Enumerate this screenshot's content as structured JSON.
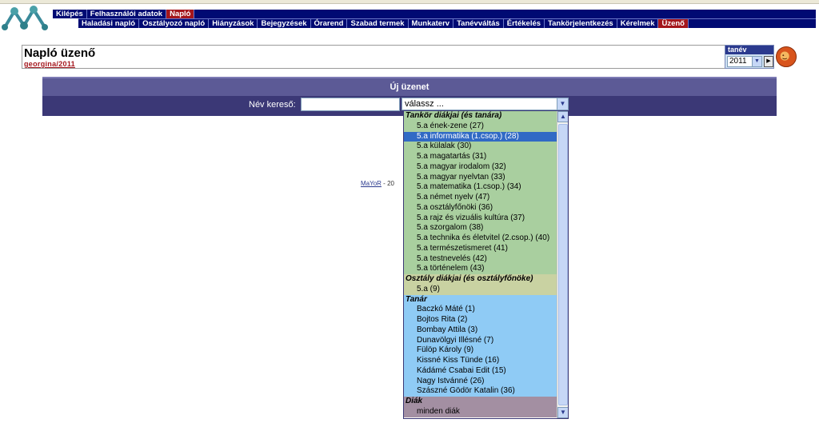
{
  "nav_top": [
    "Kilépés",
    "Felhasználói adatok",
    "Napló"
  ],
  "nav_sub": [
    "Haladási napló",
    "Osztályozó napló",
    "Hiányzások",
    "Bejegyzések",
    "Órarend",
    "Szabad termek",
    "Munkaterv",
    "Tanévváltás",
    "Értékelés",
    "Tankörjelentkezés",
    "Kérelmek",
    "Üzenő"
  ],
  "colors": {
    "nav_bg": "#000a73",
    "active": "#a4161c",
    "panel": "#3b3876",
    "selected": "#316ac5"
  },
  "header": {
    "title": "Napló üzenő",
    "user": "georgina/2011"
  },
  "year": {
    "label": "tanév",
    "value": "2011"
  },
  "panel": {
    "title": "Új üzenet",
    "search_label": "Név kereső:",
    "select_value": "válassz ..."
  },
  "dropdown": {
    "groups": [
      {
        "label": "Tankör diákjai (és tanára)",
        "options": [
          "5.a ének-zene (27)",
          "5.a informatika (1.csop.) (28)",
          "5.a külalak (30)",
          "5.a magatartás (31)",
          "5.a magyar irodalom (32)",
          "5.a magyar nyelvtan (33)",
          "5.a matematika (1.csop.) (34)",
          "5.a német nyelv (47)",
          "5.a osztályfőnöki (36)",
          "5.a rajz és vizuális kultúra (37)",
          "5.a szorgalom (38)",
          "5.a technika és életvitel (2.csop.) (40)",
          "5.a természetismeret (41)",
          "5.a testnevelés (42)",
          "5.a történelem (43)"
        ]
      },
      {
        "label": "Osztály diákjai (és osztályfőnöke)",
        "options": [
          "5.a (9)"
        ]
      },
      {
        "label": "Tanár",
        "options": [
          "Baczkó Máté (1)",
          "Bojtos Rita (2)",
          "Bombay Attila (3)",
          "Dunavölgyi Illésné (7)",
          "Fülöp Károly (9)",
          "Kissné Kiss Tünde (16)",
          "Kádámé Csabai Edit (15)",
          "Nagy Istvánné (26)",
          "Szászné Gödör Katalin (36)"
        ]
      },
      {
        "label": "Diák",
        "options": [
          "minden diák"
        ]
      }
    ],
    "selected": "5.a informatika (1.csop.) (28)"
  },
  "footer": {
    "link": "MaYoR",
    "text": " - 20"
  }
}
